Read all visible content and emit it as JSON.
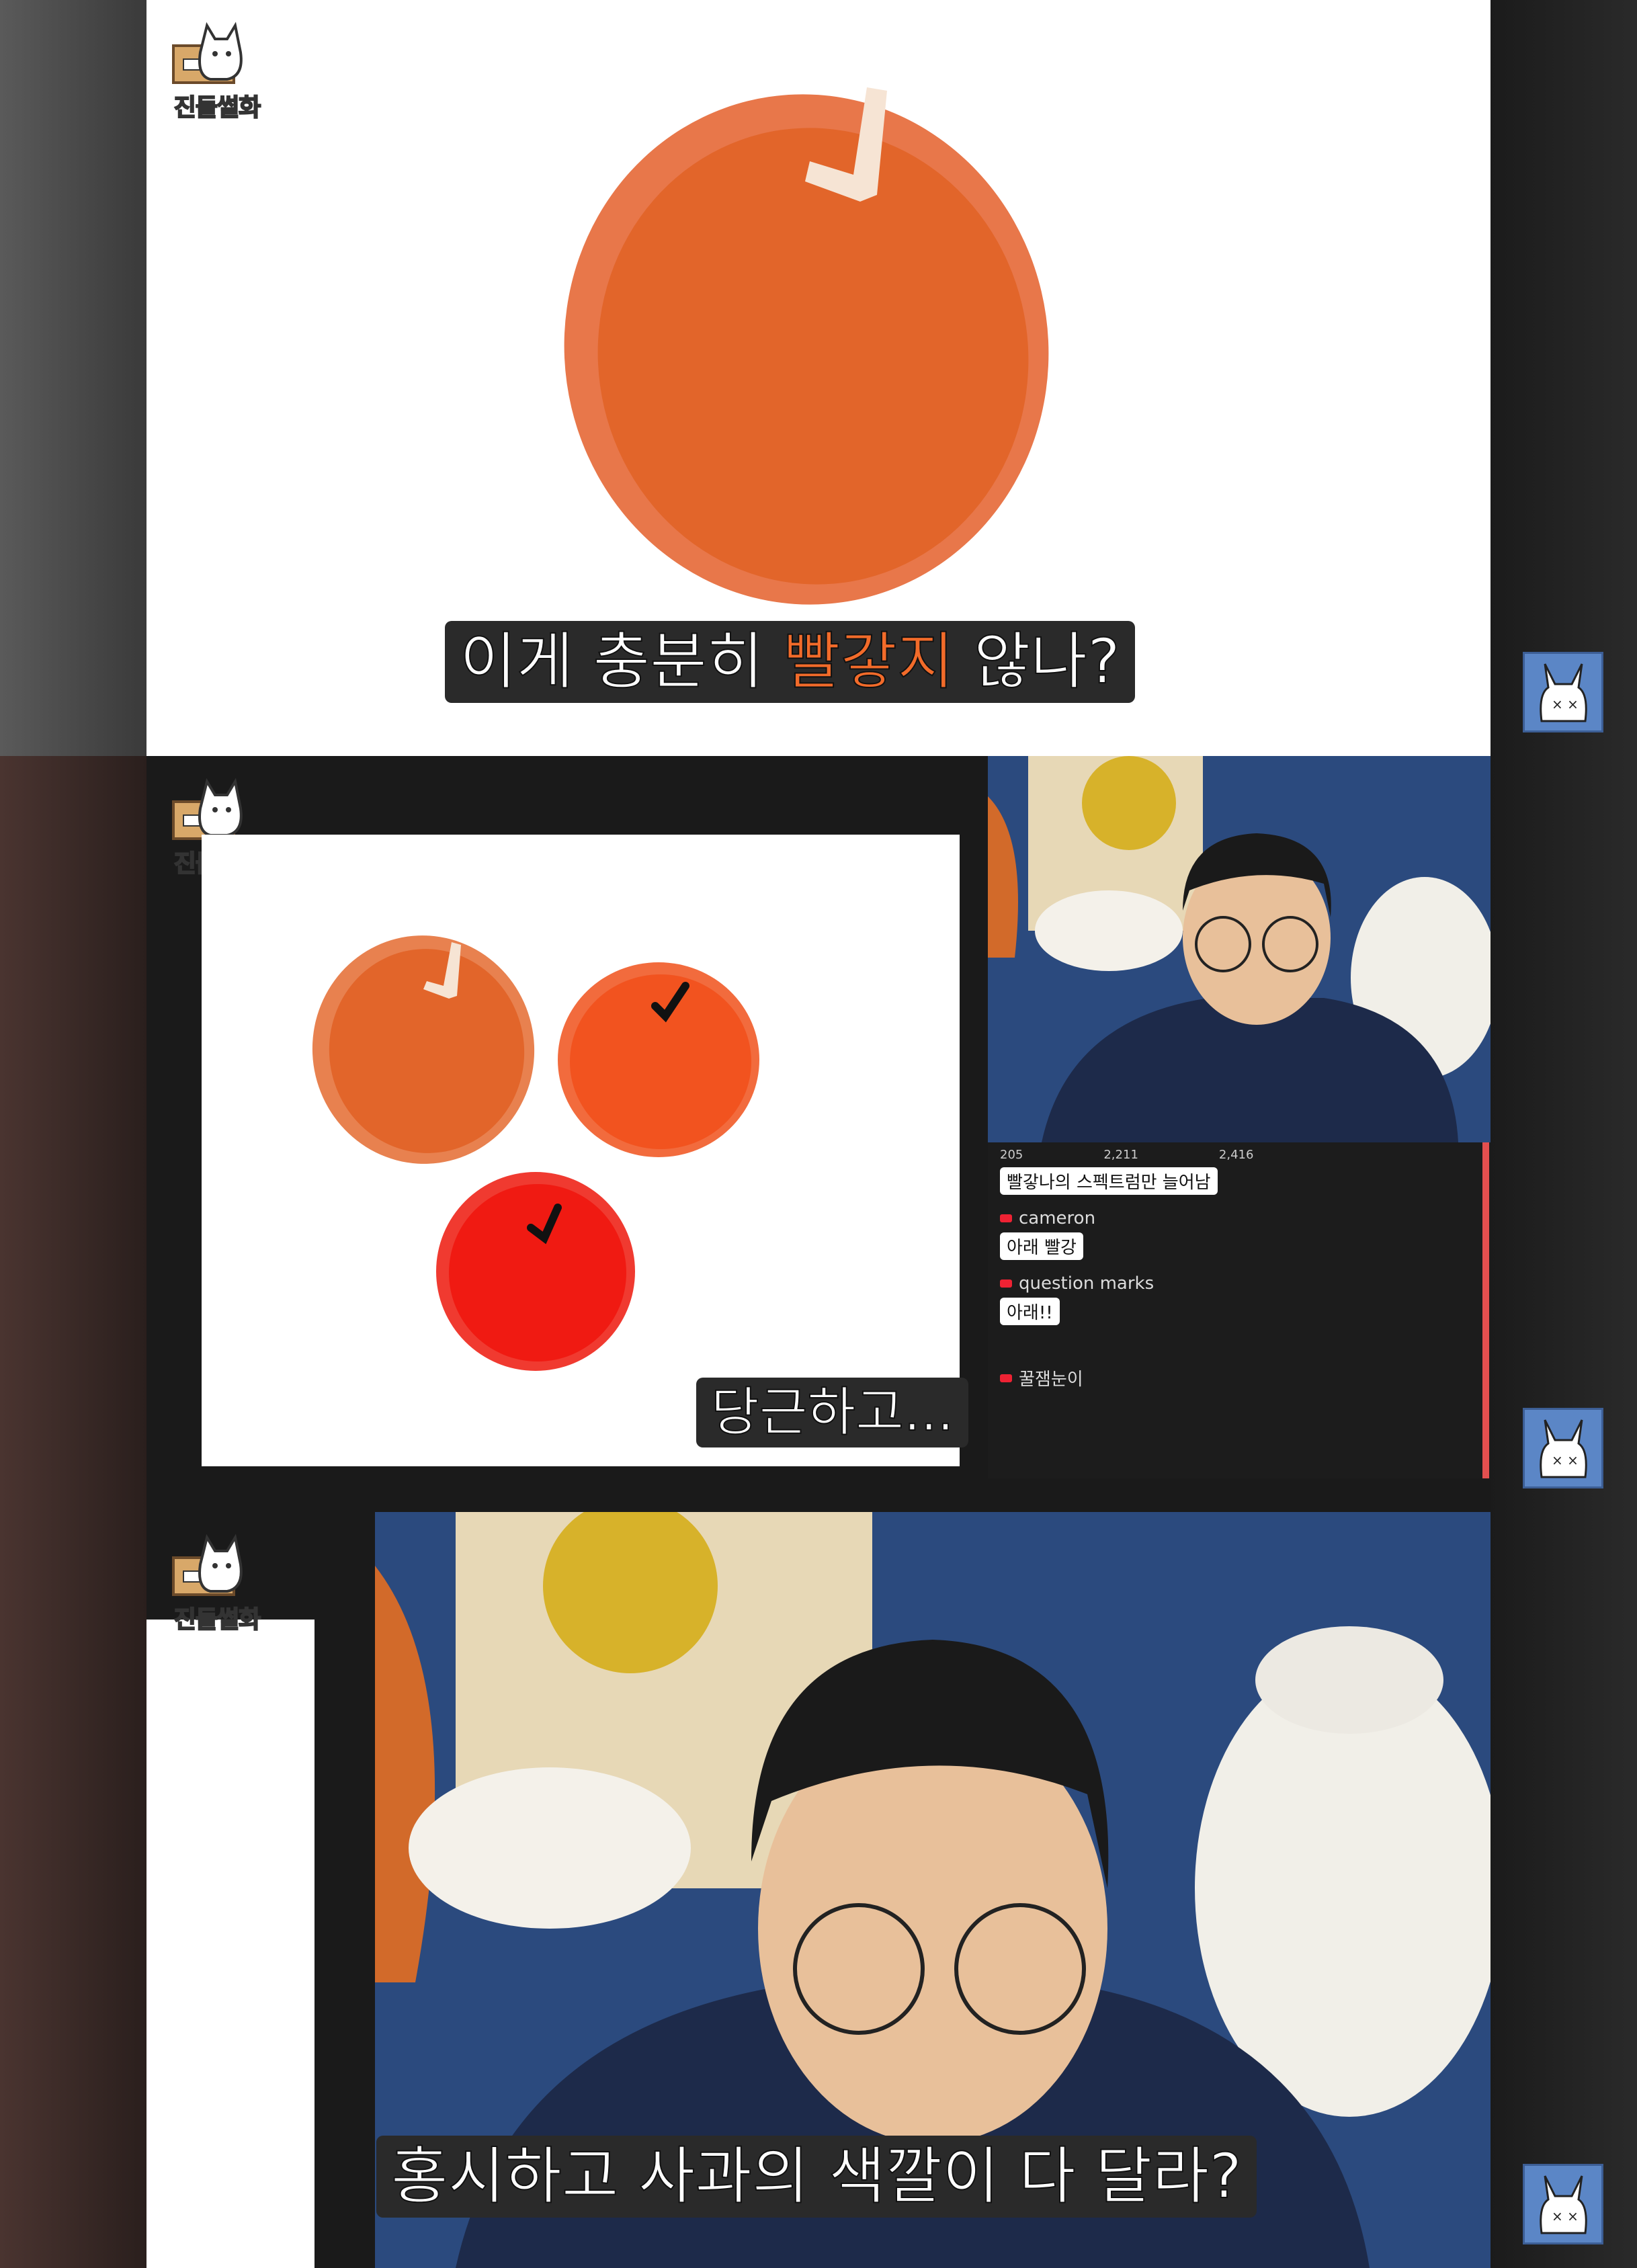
{
  "logo": {
    "text_main": "진돌",
    "text_highlight": "썰화"
  },
  "panel1": {
    "subtitle_pre": "이게 충분히 ",
    "subtitle_accent": "빨갛지",
    "subtitle_post": " 않나?"
  },
  "panel2": {
    "caption": "당근하고...",
    "stats": {
      "likes": "205",
      "views": "2,211",
      "viewers": "2,416"
    },
    "chat": [
      {
        "user": "",
        "message": "빨갛나의 스펙트럼만 늘어남"
      },
      {
        "user": "cameron",
        "message": "아래 빨강"
      },
      {
        "user": "question marks",
        "message": "아래!!"
      },
      {
        "user": "꿀잼눈이",
        "message": ""
      }
    ]
  },
  "panel3": {
    "subtitle": "홍시하고 사과의 색깔이 다 달라?"
  },
  "colors": {
    "accent": "#f26b2a",
    "carrot": "#e2652a",
    "persimmon": "#f2531f",
    "apple": "#f01a12",
    "bunny_bg": "#5b86c6"
  }
}
